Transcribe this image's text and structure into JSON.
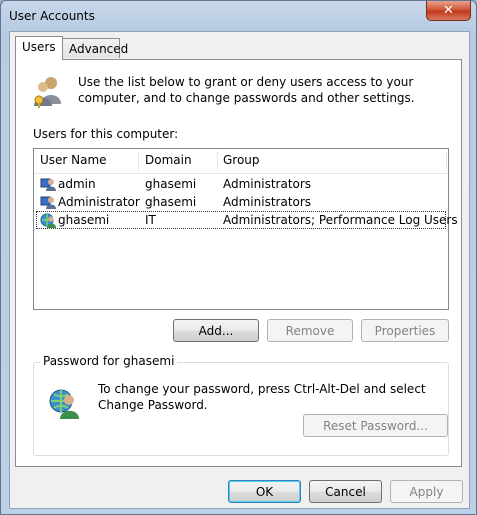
{
  "window": {
    "title": "User Accounts",
    "close_glyph": "✕"
  },
  "tabs": [
    {
      "label": "Users",
      "active": true
    },
    {
      "label": "Advanced",
      "active": false
    }
  ],
  "intro": {
    "icon": "users-keys-icon",
    "text": "Use the list below to grant or deny users access to your computer, and to change passwords and other settings."
  },
  "users_list": {
    "label": "Users for this computer:",
    "columns": [
      "User Name",
      "Domain",
      "Group"
    ],
    "rows": [
      {
        "user": "admin",
        "domain": "ghasemi",
        "group": "Administrators",
        "icon": "local-user-icon"
      },
      {
        "user": "Administrator",
        "domain": "ghasemi",
        "group": "Administrators",
        "icon": "local-user-icon"
      },
      {
        "user": "ghasemi",
        "domain": "IT",
        "group": "Administrators; Performance Log Users",
        "icon": "domain-user-icon",
        "selected": true
      }
    ]
  },
  "list_buttons": {
    "add": "Add...",
    "remove": "Remove",
    "properties": "Properties"
  },
  "password_group": {
    "title": "Password for ghasemi",
    "text": "To change your password, press Ctrl-Alt-Del and select Change Password.",
    "reset_button": "Reset Password..."
  },
  "dialog_buttons": {
    "ok": "OK",
    "cancel": "Cancel",
    "apply": "Apply"
  },
  "colors": {
    "selection_outline": "#333333",
    "default_button_border": "#3c7fb1",
    "close_button": "#c13a1e"
  }
}
